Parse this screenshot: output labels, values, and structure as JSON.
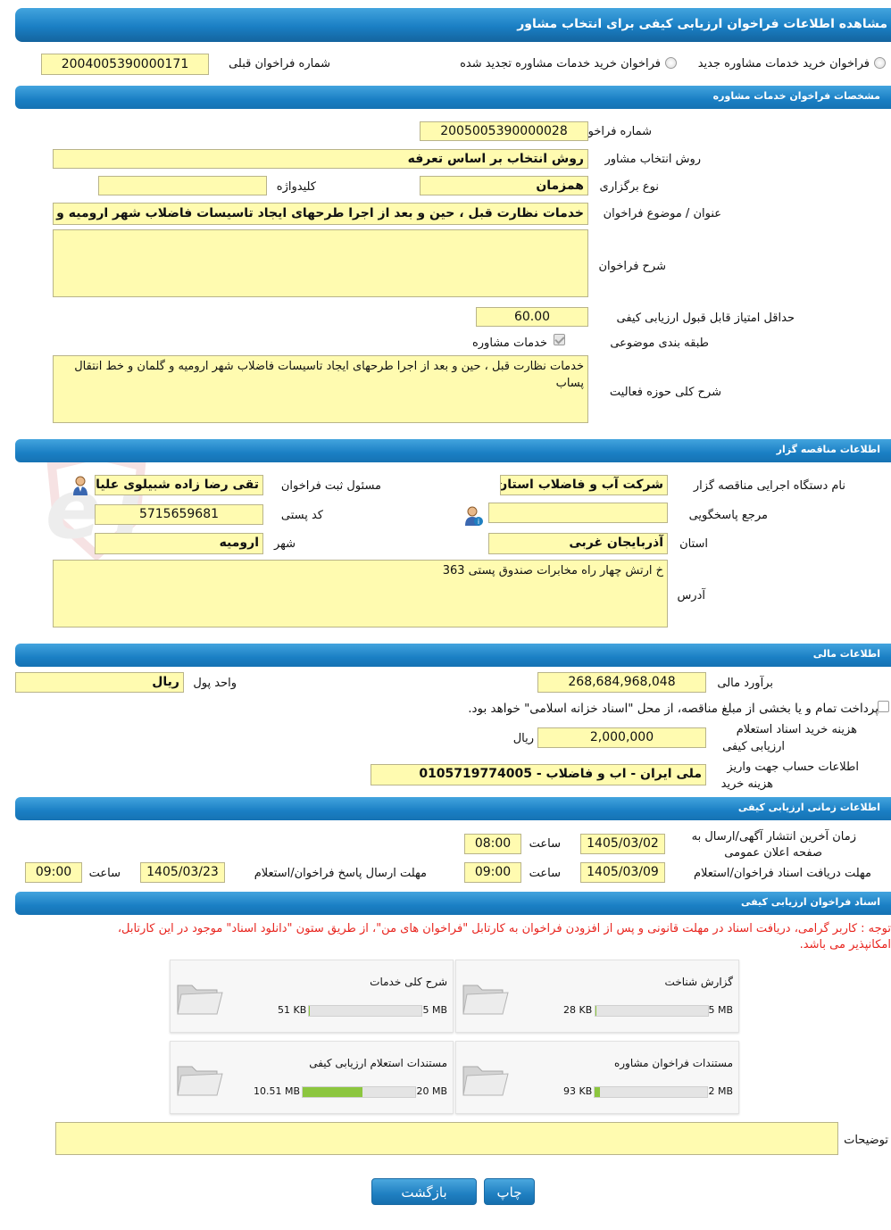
{
  "header": {
    "title": "مشاهده اطلاعات فراخوان ارزیابی کیفی برای انتخاب مشاور"
  },
  "top": {
    "radio_new": "فراخوان خرید خدمات مشاوره جدید",
    "radio_renew": "فراخوان خرید خدمات مشاوره تجدید شده",
    "prev_label": "شماره فراخوان قبلی",
    "prev_value": "2004005390000171"
  },
  "sec1": {
    "title": "مشخصات فراخوان خدمات مشاوره",
    "number_label": "شماره فراخوان",
    "number_value": "2005005390000028",
    "method_label": "روش انتخاب مشاور",
    "method_value": "روش انتخاب بر اساس تعرفه",
    "type_label": "نوع برگزاری",
    "type_value": "همزمان",
    "keyword_label": "کلیدواژه",
    "keyword_value": "",
    "subject_label": "عنوان / موضوع فراخوان",
    "subject_value": "خدمات نظارت قبل ، حین و بعد از اجرا طرحهای ایجاد تاسیسات فاضلاب شهر ارومیه و گ",
    "desc_label": "شرح فراخوان",
    "desc_value": "",
    "minscore_label": "حداقل امتیاز قابل قبول ارزیابی کیفی",
    "minscore_value": "60.00",
    "category_label": "طبقه بندی موضوعی",
    "category_check": "خدمات مشاوره",
    "scope_label": "شرح کلی حوزه فعالیت",
    "scope_value": "خدمات نظارت قبل ، حین و بعد از اجرا طرحهای ایجاد تاسیسات فاضلاب شهر ارومیه و گلمان و خط انتقال پساب"
  },
  "sec2": {
    "title": "اطلاعات مناقصه گزار",
    "org_label": "نام دستگاه اجرایی مناقصه گزار",
    "org_value": "شرکت آب و فاضلاب استان",
    "resp_label": "مسئول ثبت فراخوان",
    "resp_value": "تقی رضا زاده شبیلوی علیا",
    "ref_label": "مرجع پاسخگویی",
    "ref_value": "",
    "postal_label": "کد پستی",
    "postal_value": "5715659681",
    "province_label": "استان",
    "province_value": "آذربایجان غربی",
    "city_label": "شهر",
    "city_value": "ارومیه",
    "address_label": "آدرس",
    "address_value": "خ ارتش چهار راه مخابرات صندوق پستی 363"
  },
  "sec3": {
    "title": "اطلاعات مالی",
    "estimate_label": "برآورد مالی",
    "estimate_value": "268,684,968,048",
    "currency_label": "واحد پول",
    "currency_value": "ریال",
    "treasury_text": "پرداخت تمام و یا بخشی از مبلغ مناقصه، از محل \"اسناد خزانه اسلامی\" خواهد بود.",
    "fee_label_1": "هزینه خرید اسناد استعلام",
    "fee_label_2": "ارزیابی کیفی",
    "fee_value": "2,000,000",
    "fee_unit": "ریال",
    "account_label_1": "اطلاعات حساب جهت واریز",
    "account_label_2": "هزینه خرید",
    "account_value": "ملی ایران - اب و فاضلاب - 0105719774005"
  },
  "sec4": {
    "title": "اطلاعات زمانی ارزیابی کیفی",
    "publish_label_1": "زمان آخرین انتشار آگهی/ارسال به",
    "publish_label_2": "صفحه اعلان عمومی",
    "publish_date": "1405/03/02",
    "time_label": "ساعت",
    "publish_time": "08:00",
    "receive_label": "مهلت دریافت اسناد فراخوان/استعلام",
    "receive_date": "1405/03/09",
    "receive_time": "09:00",
    "send_label": "مهلت ارسال پاسخ فراخوان/استعلام",
    "send_date": "1405/03/23",
    "send_time": "09:00"
  },
  "sec5": {
    "title": "اسناد فراخوان ارزیابی کیفی",
    "notice_1": "توجه : کاربر گرامی، دریافت اسناد در مهلت قانونی و پس از افزودن فراخوان به کارتابل \"فراخوان های من\"، از طریق ستون \"دانلود اسناد\" موجود در این کارتابل،",
    "notice_2": "امکانپذیر می باشد.",
    "docs": [
      {
        "name": "گزارش شناخت",
        "size": "28 KB",
        "max": "5 MB",
        "fill": 0.005
      },
      {
        "name": "شرح کلی خدمات",
        "size": "51 KB",
        "max": "5 MB",
        "fill": 0.01
      },
      {
        "name": "مستندات فراخوان مشاوره",
        "size": "93 KB",
        "max": "2 MB",
        "fill": 0.045
      },
      {
        "name": "مستندات استعلام ارزیابی کیفی",
        "size": "10.51 MB",
        "max": "20 MB",
        "fill": 0.53
      }
    ],
    "notes_label": "توضیحات",
    "notes_value": ""
  },
  "buttons": {
    "print": "چاپ",
    "back": "بازگشت"
  },
  "watermark": {
    "text": "AriaTender.neT"
  }
}
